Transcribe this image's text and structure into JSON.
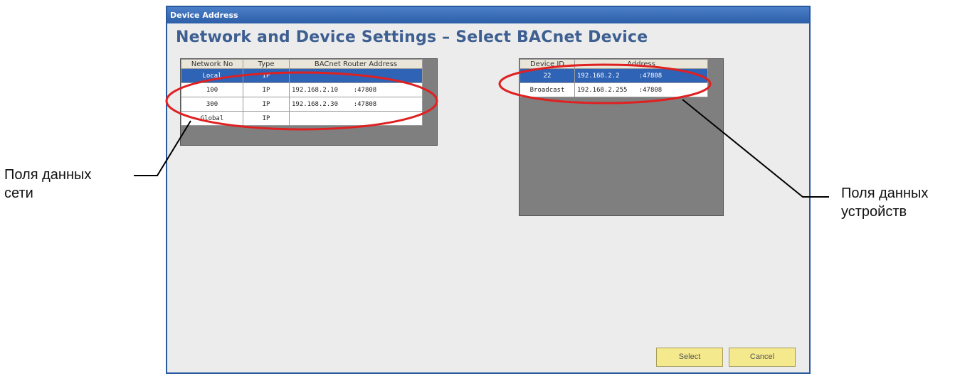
{
  "window": {
    "title": "Device Address",
    "heading": "Network and Device Settings  –  Select BACnet Device"
  },
  "network_table": {
    "headers": [
      "Network No",
      "Type",
      "BACnet Router Address"
    ],
    "rows": [
      {
        "network_no": "Local",
        "type": "IP",
        "address": "",
        "port": "",
        "selected": true
      },
      {
        "network_no": "100",
        "type": "IP",
        "address": "192.168.2.10",
        "port": ":47808",
        "selected": false
      },
      {
        "network_no": "300",
        "type": "IP",
        "address": "192.168.2.30",
        "port": ":47808",
        "selected": false
      },
      {
        "network_no": "Global",
        "type": "IP",
        "address": "",
        "port": "",
        "selected": false
      }
    ]
  },
  "device_table": {
    "headers": [
      "Device ID",
      "Address"
    ],
    "rows": [
      {
        "device_id": "22",
        "address": "192.168.2.2",
        "port": ":47808",
        "selected": true
      },
      {
        "device_id": "Broadcast",
        "address": "192.168.2.255",
        "port": ":47808",
        "selected": false
      }
    ]
  },
  "buttons": {
    "select": "Select",
    "cancel": "Cancel"
  },
  "annotations": {
    "network_line1": "Поля данных",
    "network_line2": "сети",
    "device_line1": "Поля данных",
    "device_line2": "устройств"
  },
  "colors": {
    "title_bar": "#2d5fa8",
    "selected_row": "#2f63b5",
    "highlight_ellipse": "#e02020",
    "button": "#f5e98d"
  }
}
